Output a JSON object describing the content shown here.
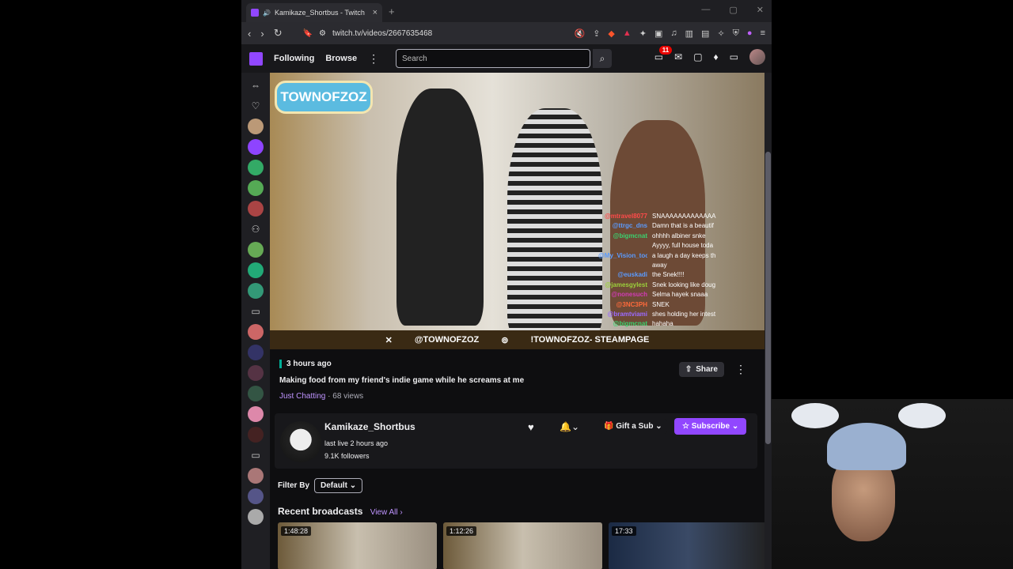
{
  "browser": {
    "tab_title": "Kamikaze_Shortbus - Twitch",
    "new_tab": "+",
    "tab_close": "×",
    "url": "twitch.tv/videos/2667635468",
    "window_controls": [
      "—",
      "▢",
      "✕"
    ]
  },
  "twitch_nav": {
    "following": "Following",
    "browse": "Browse",
    "more": "⋮",
    "search_placeholder": "Search",
    "notification_count": "11"
  },
  "video": {
    "logo_text": "TOWNOFZOZ",
    "banner_left": "@TOWNOFZOZ",
    "banner_right": "!TOWNOFZOZ- STEAMPAGE",
    "chat": [
      {
        "user": "@mtravel8077",
        "msg": "SNAAAAAAAAAAAAA",
        "color": "#ff4a4a"
      },
      {
        "user": "@ttrgc_dns",
        "msg": "Damn that is a beautif",
        "color": "#5a9bff"
      },
      {
        "user": "@bigmcnat",
        "msg": "ohhhh albiner snke",
        "color": "#3bd16f"
      },
      {
        "user": "",
        "msg": "Ayyyy, full house toda",
        "color": "#ffffff"
      },
      {
        "user": "@My_Vision_too",
        "msg": "a laugh a day keeps th",
        "color": "#5a9bff"
      },
      {
        "user": "",
        "msg": "away",
        "color": "#ffffff"
      },
      {
        "user": "@euskadi",
        "msg": "the Snek!!!!",
        "color": "#5a9bff"
      },
      {
        "user": "@jamesgylest",
        "msg": "Snek looking like doug",
        "color": "#9bd13b"
      },
      {
        "user": "@nonesuch",
        "msg": "Selma hayek snaaa",
        "color": "#d13bb5"
      },
      {
        "user": "@3NC3PH",
        "msg": "SNEK",
        "color": "#ff6a3b"
      },
      {
        "user": "@bramtviami",
        "msg": "shes holding her intest",
        "color": "#9b6aff"
      },
      {
        "user": "@bigmcnat",
        "msg": "hahaha",
        "color": "#3bd16f"
      }
    ]
  },
  "info": {
    "time_ago": "3 hours ago",
    "title": "Making food from my friend's indie game while he screams at me",
    "category": "Just Chatting",
    "views": " · 68 views",
    "share": "Share",
    "more": "⋮"
  },
  "channel": {
    "name": "Kamikaze_Shortbus",
    "last_live": "last live 2 hours ago",
    "followers": "9.1K followers",
    "gift": "Gift a Sub",
    "subscribe": "Subscribe"
  },
  "filter": {
    "label": "Filter By",
    "value": "Default"
  },
  "recent": {
    "heading": "Recent broadcasts",
    "view_all": "View All ›",
    "thumbs": [
      {
        "duration": "1:48:28"
      },
      {
        "duration": "1:12:26"
      },
      {
        "duration": "17:33"
      }
    ]
  }
}
